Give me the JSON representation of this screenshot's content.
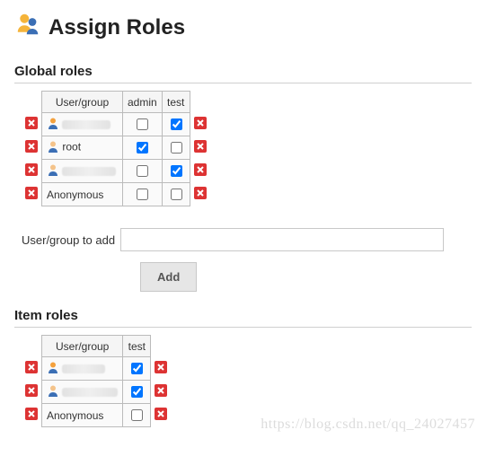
{
  "page": {
    "title": "Assign Roles"
  },
  "sections": {
    "global": {
      "heading": "Global roles",
      "columns": [
        "User/group",
        "admin",
        "test"
      ],
      "rows": [
        {
          "name": "",
          "blurred": true,
          "icon": "user-female",
          "checks": {
            "admin": false,
            "test": true
          }
        },
        {
          "name": "root",
          "blurred": false,
          "icon": "user-male",
          "checks": {
            "admin": true,
            "test": false
          }
        },
        {
          "name": "",
          "blurred": true,
          "icon": "user-male",
          "checks": {
            "admin": false,
            "test": true
          }
        },
        {
          "name": "Anonymous",
          "blurred": false,
          "icon": "none",
          "checks": {
            "admin": false,
            "test": false
          }
        }
      ]
    },
    "item": {
      "heading": "Item roles",
      "columns": [
        "User/group",
        "test"
      ],
      "rows": [
        {
          "name": "",
          "blurred": true,
          "icon": "user-female",
          "checks": {
            "test": true
          }
        },
        {
          "name": "",
          "blurred": true,
          "icon": "user-male",
          "checks": {
            "test": true
          }
        },
        {
          "name": "Anonymous",
          "blurred": false,
          "icon": "none",
          "checks": {
            "test": false
          }
        }
      ]
    }
  },
  "addForm": {
    "label": "User/group to add",
    "value": "",
    "buttonLabel": "Add"
  },
  "watermark": "https://blog.csdn.net/qq_24027457"
}
